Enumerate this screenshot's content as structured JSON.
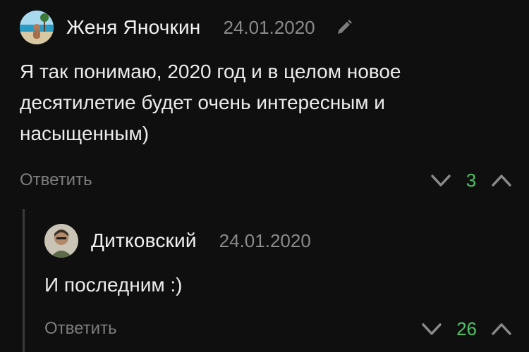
{
  "comments": [
    {
      "author": "Женя Яночкин",
      "date": "24.01.2020",
      "text": "Я так понимаю, 2020 год и в целом новое десятилетие будет очень интересным и насыщенным)",
      "reply_label": "Ответить",
      "score": "3",
      "icons": {
        "avatar": "avatar-beach",
        "edit": "pencil-icon",
        "down": "chevron-down-icon",
        "up": "chevron-up-icon"
      }
    },
    {
      "author": "Дитковский",
      "date": "24.01.2020",
      "text": "И последним :)",
      "reply_label": "Ответить",
      "score": "26",
      "icons": {
        "avatar": "avatar-person",
        "down": "chevron-down-icon",
        "up": "chevron-up-icon"
      }
    }
  ],
  "colors": {
    "background": "#0f0f0f",
    "score": "#4ec266",
    "muted": "#8a8a8a",
    "text": "#ececec"
  }
}
